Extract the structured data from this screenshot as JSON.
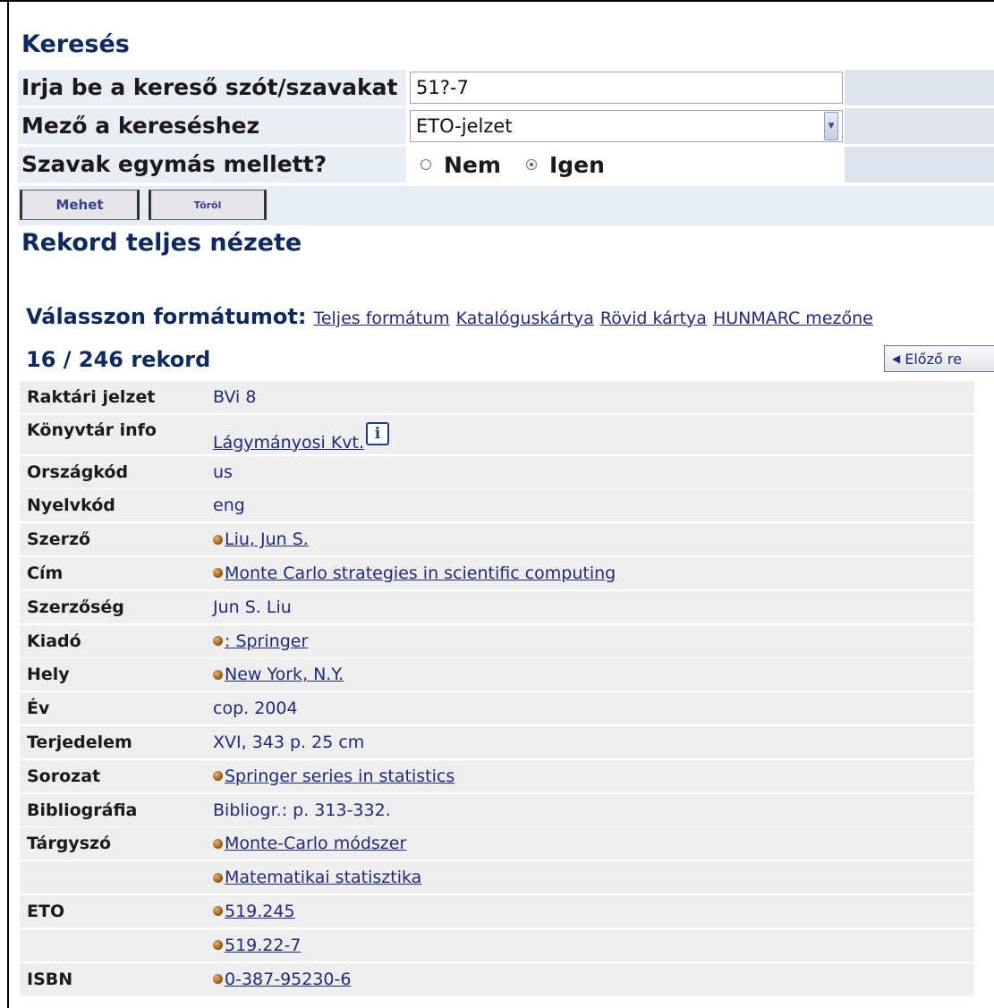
{
  "search": {
    "title": "Keresés",
    "query_label": "Irja be a kereső szót/szavakat",
    "query_value": "51?-7",
    "field_label": "Mező a kereséshez",
    "field_value": "ETO-jelzet",
    "adjacent_label": "Szavak egymás mellett?",
    "adjacent_options": [
      "Nem",
      "Igen"
    ],
    "adjacent_selected": "Igen",
    "go_button": "Mehet",
    "clear_button": "Töröl"
  },
  "record_view": {
    "title": "Rekord teljes nézete",
    "format_label": "Válasszon formátumot:",
    "format_links": [
      "Teljes formátum",
      "Katalóguskártya",
      "Rövid kártya",
      "HUNMARC mezőne"
    ],
    "counter": "16 / 246 rekord",
    "prev_button": "Előző re"
  },
  "records": [
    {
      "field": "Raktári jelzet",
      "value": "BVi 8",
      "link": false,
      "bullet": false
    },
    {
      "field": "Könyvtár info",
      "value": "Lágymányosi Kvt.",
      "link": true,
      "bullet": false,
      "info_icon": "info-icon"
    },
    {
      "field": "Országkód",
      "value": "us",
      "link": false,
      "bullet": false
    },
    {
      "field": "Nyelvkód",
      "value": "eng",
      "link": false,
      "bullet": false
    },
    {
      "field": "Szerző",
      "value": "Liu, Jun S.",
      "link": true,
      "bullet": true
    },
    {
      "field": "Cím",
      "value": "Monte Carlo strategies in scientific computing",
      "link": true,
      "bullet": true
    },
    {
      "field": "Szerzőség",
      "value": "Jun S. Liu",
      "link": false,
      "bullet": false
    },
    {
      "field": "Kiadó",
      "value": ": Springer",
      "link": true,
      "bullet": true
    },
    {
      "field": "Hely",
      "value": "New York, N.Y.",
      "link": true,
      "bullet": true
    },
    {
      "field": "Év",
      "value": "cop. 2004",
      "link": false,
      "bullet": false
    },
    {
      "field": "Terjedelem",
      "value": "XVI, 343 p. 25 cm",
      "link": false,
      "bullet": false
    },
    {
      "field": "Sorozat",
      "value": "Springer series in statistics",
      "link": true,
      "bullet": true
    },
    {
      "field": "Bibliográfia",
      "value": "Bibliogr.: p. 313-332.",
      "link": false,
      "bullet": false
    },
    {
      "field": "Tárgyszó",
      "value": "Monte-Carlo módszer",
      "link": true,
      "bullet": true
    },
    {
      "field": "",
      "value": "Matematikai statisztika",
      "link": true,
      "bullet": true
    },
    {
      "field": "ETO",
      "value": "519.245",
      "link": true,
      "bullet": true
    },
    {
      "field": "",
      "value": "519.22-7",
      "link": true,
      "bullet": true
    },
    {
      "field": "ISBN",
      "value": "0-387-95230-6",
      "link": true,
      "bullet": true
    }
  ],
  "colors": {
    "heading": "#0d2a5e",
    "link": "#1f2a78",
    "row_bg": "#eeeeee",
    "form_bg": "#e9edf4"
  }
}
